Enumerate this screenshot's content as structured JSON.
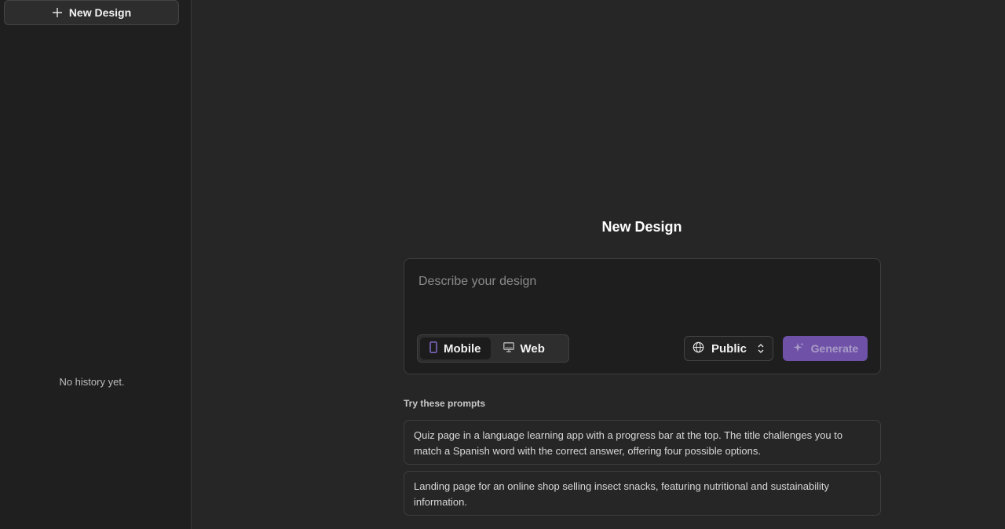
{
  "sidebar": {
    "new_design_label": "New Design",
    "empty_history": "No history yet."
  },
  "main": {
    "title": "New Design",
    "input_placeholder": "Describe your design",
    "device_options": [
      {
        "label": "Mobile",
        "icon": "phone-icon",
        "active": true
      },
      {
        "label": "Web",
        "icon": "monitor-icon",
        "active": false
      }
    ],
    "visibility": {
      "label": "Public",
      "icon": "globe-icon"
    },
    "generate_label": "Generate",
    "prompts_heading": "Try these prompts",
    "prompts": [
      "Quiz page in a language learning app with a progress bar at the top. The title challenges you to match a Spanish word with the correct answer, offering four possible options.",
      "Landing page for an online shop selling insect snacks, featuring nutritional and sustainability information."
    ]
  },
  "colors": {
    "background": "#262626",
    "sidebar": "#1f1f1f",
    "accent": "#6f52a8",
    "accent_icon": "#8b6fd6"
  }
}
